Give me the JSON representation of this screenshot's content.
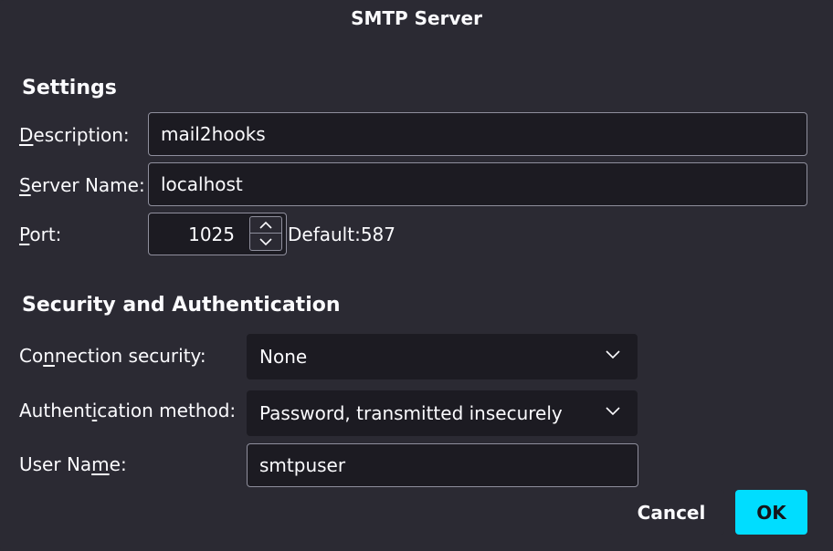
{
  "dialog": {
    "title": "SMTP Server"
  },
  "settings": {
    "heading": "Settings",
    "description": {
      "label_hot": "D",
      "label_rest": "escription:",
      "value": "mail2hooks"
    },
    "server_name": {
      "label_hot": "S",
      "label_rest": "erver Name:",
      "value": "localhost"
    },
    "port": {
      "label_hot": "P",
      "label_rest": "ort:",
      "value": "1025",
      "default_text": "Default:587"
    }
  },
  "security": {
    "heading": "Security and Authentication",
    "connection": {
      "label_pre": "Co",
      "label_hot": "n",
      "label_post": "nection security:",
      "value": "None"
    },
    "auth": {
      "label_pre": "Authent",
      "label_hot": "i",
      "label_post": "cation method:",
      "value": "Password, transmitted insecurely"
    },
    "user_name": {
      "label_pre": "User Na",
      "label_hot": "m",
      "label_post": "e:",
      "value": "smtpuser"
    }
  },
  "buttons": {
    "cancel": "Cancel",
    "ok": "OK"
  },
  "icons": {
    "spin_up": "chevron-up-icon",
    "spin_down": "chevron-down-icon",
    "dropdown": "chevron-down-icon"
  },
  "colors": {
    "background": "#2b2a33",
    "field": "#1c1b22",
    "accent": "#00ddff"
  }
}
